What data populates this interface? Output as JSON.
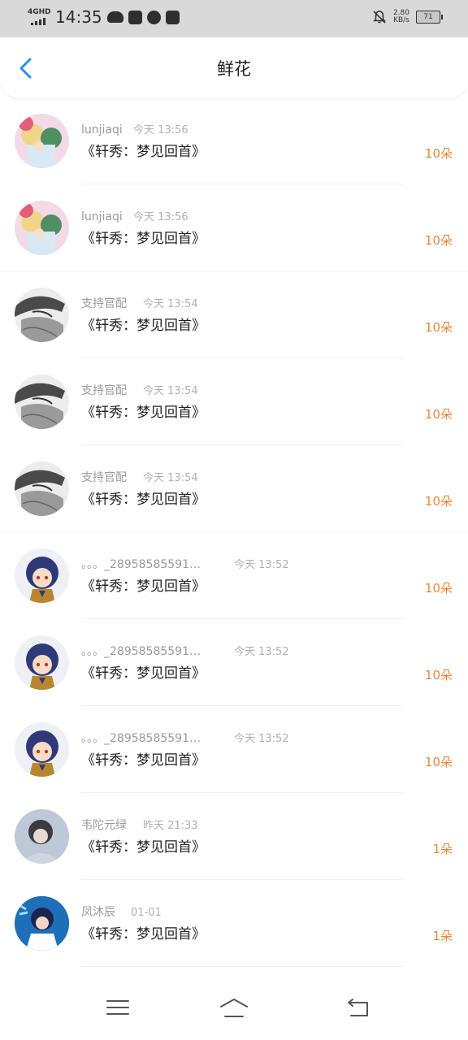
{
  "status_bar": {
    "network": "4GHD",
    "time": "14:35",
    "speed_value": "2.80",
    "speed_unit": "KB/s",
    "battery": "71"
  },
  "header": {
    "title": "鲜花",
    "back_icon": "chevron-left-icon",
    "accent_color": "#2b8ff0"
  },
  "gifts": [
    {
      "user": "lunjiaqi",
      "time": "今天 13:56",
      "work": "《轩秀：梦见回首》",
      "count": "10朵",
      "avatar": "anime-pair"
    },
    {
      "user": "lunjiaqi",
      "time": "今天 13:56",
      "work": "《轩秀：梦见回首》",
      "count": "10朵",
      "avatar": "anime-pair"
    },
    {
      "user": "支持官配",
      "time": "今天 13:54",
      "work": "《轩秀：梦见回首》",
      "count": "10朵",
      "avatar": "sketch"
    },
    {
      "user": "支持官配",
      "time": "今天 13:54",
      "work": "《轩秀：梦见回首》",
      "count": "10朵",
      "avatar": "sketch"
    },
    {
      "user": "支持官配",
      "time": "今天 13:54",
      "work": "《轩秀：梦见回首》",
      "count": "10朵",
      "avatar": "sketch"
    },
    {
      "user": "。。。_28958585591…",
      "time": "今天 13:52",
      "work": "《轩秀：梦见回首》",
      "count": "10朵",
      "avatar": "chibi"
    },
    {
      "user": "。。。_28958585591…",
      "time": "今天 13:52",
      "work": "《轩秀：梦见回首》",
      "count": "10朵",
      "avatar": "chibi"
    },
    {
      "user": "。。。_28958585591…",
      "time": "今天 13:52",
      "work": "《轩秀：梦见回首》",
      "count": "10朵",
      "avatar": "chibi"
    },
    {
      "user": "韦陀元绿",
      "time": "昨天 21:33",
      "work": "《轩秀：梦见回首》",
      "count": "1朵",
      "avatar": "photo"
    },
    {
      "user": "凤沐辰",
      "time": "01-01",
      "work": "《轩秀：梦见回首》",
      "count": "1朵",
      "avatar": "blue-art"
    }
  ],
  "colors": {
    "count": "#e8873a",
    "username": "#9a9a9a",
    "timestamp": "#b0b0b0"
  },
  "nav_bar": {
    "menu_icon": "menu-icon",
    "home_icon": "home-icon",
    "back_icon": "back-arrow-icon"
  }
}
